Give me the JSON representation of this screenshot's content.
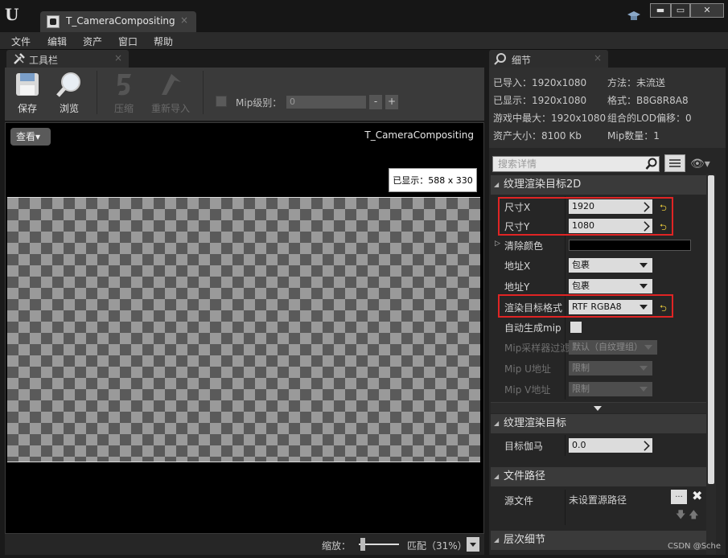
{
  "window": {
    "tab_title": "T_CameraCompositing",
    "tab_close": "×",
    "minimize": "▬",
    "maximize": "▭",
    "close": "✕"
  },
  "menu": [
    "文件",
    "编辑",
    "资产",
    "窗口",
    "帮助"
  ],
  "toolbar_panel": {
    "title": "工具栏",
    "close": "×"
  },
  "toolbar": {
    "save": "保存",
    "browse": "浏览",
    "compress": "压缩",
    "reimport": "重新导入",
    "mip_label": "Mip级别：",
    "mip_value": "0",
    "minus": "-",
    "plus": "+"
  },
  "viewport": {
    "view_button": "查看▾",
    "asset_name": "T_CameraCompositing",
    "displayed": "已显示：588 x 330"
  },
  "zoombar": {
    "label": "缩放：",
    "value": "匹配（31%）"
  },
  "details": {
    "title": "细节",
    "close": "×",
    "stats": {
      "imported": "已导入：1920x1080",
      "method": "方法：未流送",
      "displayed": "已显示：1920x1080",
      "format": "格式：B8G8R8A8",
      "max_ingame": "游戏中最大：1920x1080",
      "lod_bias": "组合的LOD偏移：0",
      "resource_size": "资产大小：8100 Kb",
      "mip_count": "Mip数量：1"
    },
    "search_placeholder": "搜索详情",
    "sections": {
      "rt2d": "纹理渲染目标2D",
      "rt": "纹理渲染目标",
      "file_path": "文件路径",
      "lod": "层次细节"
    },
    "props": {
      "size_x_label": "尺寸X",
      "size_x": "1920",
      "size_y_label": "尺寸Y",
      "size_y": "1080",
      "clear_color_label": "清除颜色",
      "address_x_label": "地址X",
      "address_x": "包裹",
      "address_y_label": "地址Y",
      "address_y": "包裹",
      "rt_format_label": "渲染目标格式",
      "rt_format": "RTF RGBA8",
      "auto_mip_label": "自动生成mip",
      "mip_filter_label": "Mip采样器过滤",
      "mip_filter": "默认（自纹理组）",
      "mip_u_label": "Mip U地址",
      "mip_u": "限制",
      "mip_v_label": "Mip V地址",
      "mip_v": "限制",
      "gamma_label": "目标伽马",
      "gamma": "0.0",
      "source_label": "源文件",
      "source": "未设置源路径",
      "browse": "..."
    }
  },
  "watermark": "CSDN @Sche",
  "colors": {
    "highlight": "#e02424",
    "reset_arrow": "#e0c23a"
  }
}
